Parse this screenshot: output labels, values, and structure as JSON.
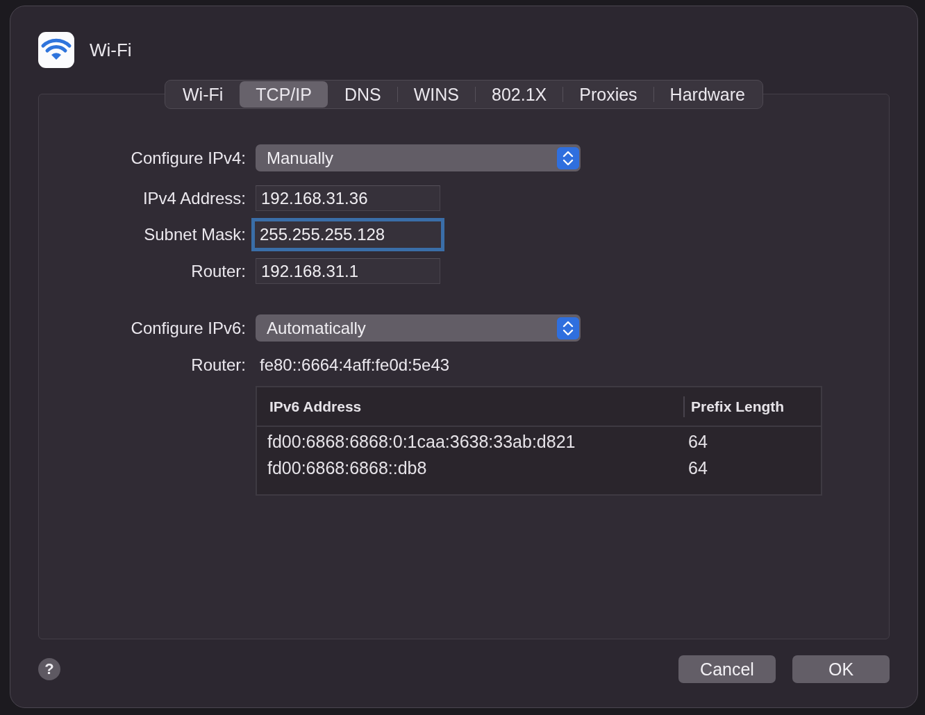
{
  "window": {
    "title": "Wi-Fi"
  },
  "tabs": [
    {
      "label": "Wi-Fi",
      "selected": false
    },
    {
      "label": "TCP/IP",
      "selected": true
    },
    {
      "label": "DNS",
      "selected": false
    },
    {
      "label": "WINS",
      "selected": false
    },
    {
      "label": "802.1X",
      "selected": false
    },
    {
      "label": "Proxies",
      "selected": false
    },
    {
      "label": "Hardware",
      "selected": false
    }
  ],
  "ipv4": {
    "configure": {
      "label": "Configure IPv4:",
      "value": "Manually"
    },
    "fields": [
      {
        "label": "IPv4 Address:",
        "value": "192.168.31.36",
        "focused": false
      },
      {
        "label": "Subnet Mask:",
        "value": "255.255.255.128",
        "focused": true
      },
      {
        "label": "Router:",
        "value": "192.168.31.1",
        "focused": false
      }
    ]
  },
  "ipv6": {
    "configure": {
      "label": "Configure IPv6:",
      "value": "Automatically"
    },
    "router": {
      "label": "Router:",
      "value": "fe80::6664:4aff:fe0d:5e43"
    },
    "table": {
      "columns": [
        "IPv6 Address",
        "Prefix Length"
      ],
      "rows": [
        [
          "fd00:6868:6868:0:1caa:3638:33ab:d821",
          "64"
        ],
        [
          "fd00:6868:6868::db8",
          "64"
        ]
      ]
    }
  },
  "help": "?",
  "buttons": [
    {
      "label": "Cancel"
    },
    {
      "label": "OK"
    }
  ]
}
